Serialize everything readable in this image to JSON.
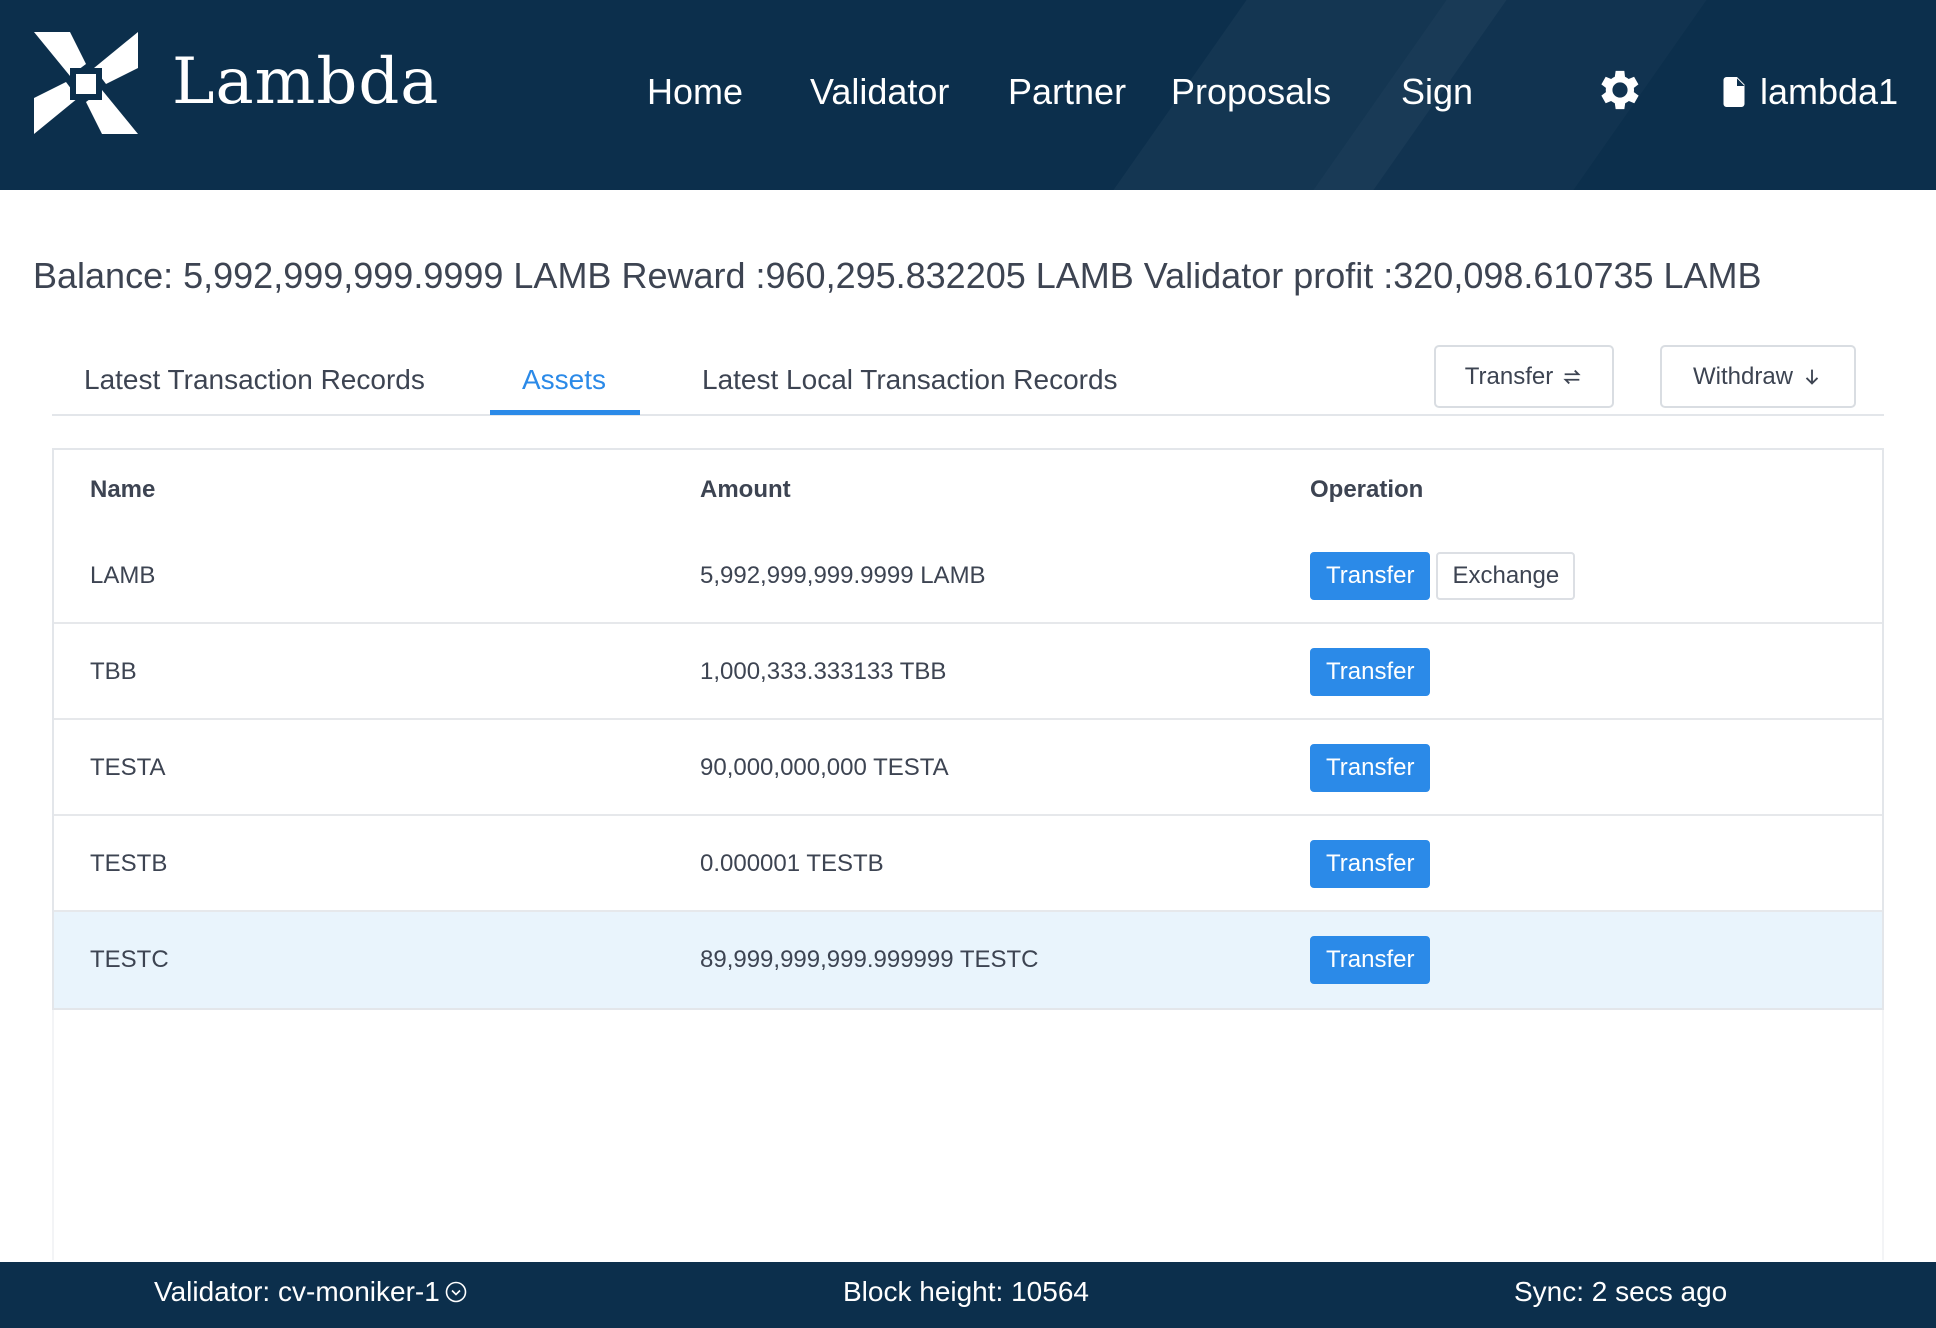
{
  "header": {
    "logo_text": "Lambda",
    "nav": [
      "Home",
      "Validator",
      "Partner",
      "Proposals",
      "Sign"
    ],
    "account_name": "lambda1",
    "icons": {
      "logo": "lambda-logo-icon",
      "settings": "gear-icon",
      "account": "document-icon"
    }
  },
  "balance": {
    "text": "Balance: 5,992,999,999.9999 LAMB Reward :960,295.832205 LAMB Validator profit :320,098.610735 LAMB"
  },
  "tabs": {
    "items": [
      "Latest Transaction Records",
      "Assets",
      "Latest Local Transaction Records"
    ],
    "active": "Assets"
  },
  "actions": {
    "transfer_label": "Transfer",
    "withdraw_label": "Withdraw"
  },
  "table": {
    "headers": [
      "Name",
      "Amount",
      "Operation"
    ],
    "rows": [
      {
        "name": "LAMB",
        "amount": "5,992,999,999.9999 LAMB",
        "ops": [
          "Transfer",
          "Exchange"
        ]
      },
      {
        "name": "TBB",
        "amount": "1,000,333.333133 TBB",
        "ops": [
          "Transfer"
        ]
      },
      {
        "name": "TESTA",
        "amount": "90,000,000,000 TESTA",
        "ops": [
          "Transfer"
        ]
      },
      {
        "name": "TESTB",
        "amount": "0.000001 TESTB",
        "ops": [
          "Transfer"
        ]
      },
      {
        "name": "TESTC",
        "amount": "89,999,999,999.999999 TESTC",
        "ops": [
          "Transfer"
        ]
      }
    ]
  },
  "footer": {
    "validator": "Validator: cv-moniker-1",
    "block_height": "Block height: 10564",
    "sync": "Sync: 2 secs ago"
  },
  "colors": {
    "header_bg": "#0c2f4c",
    "accent": "#2b8ae8",
    "row_highlight": "#e9f4fc"
  }
}
